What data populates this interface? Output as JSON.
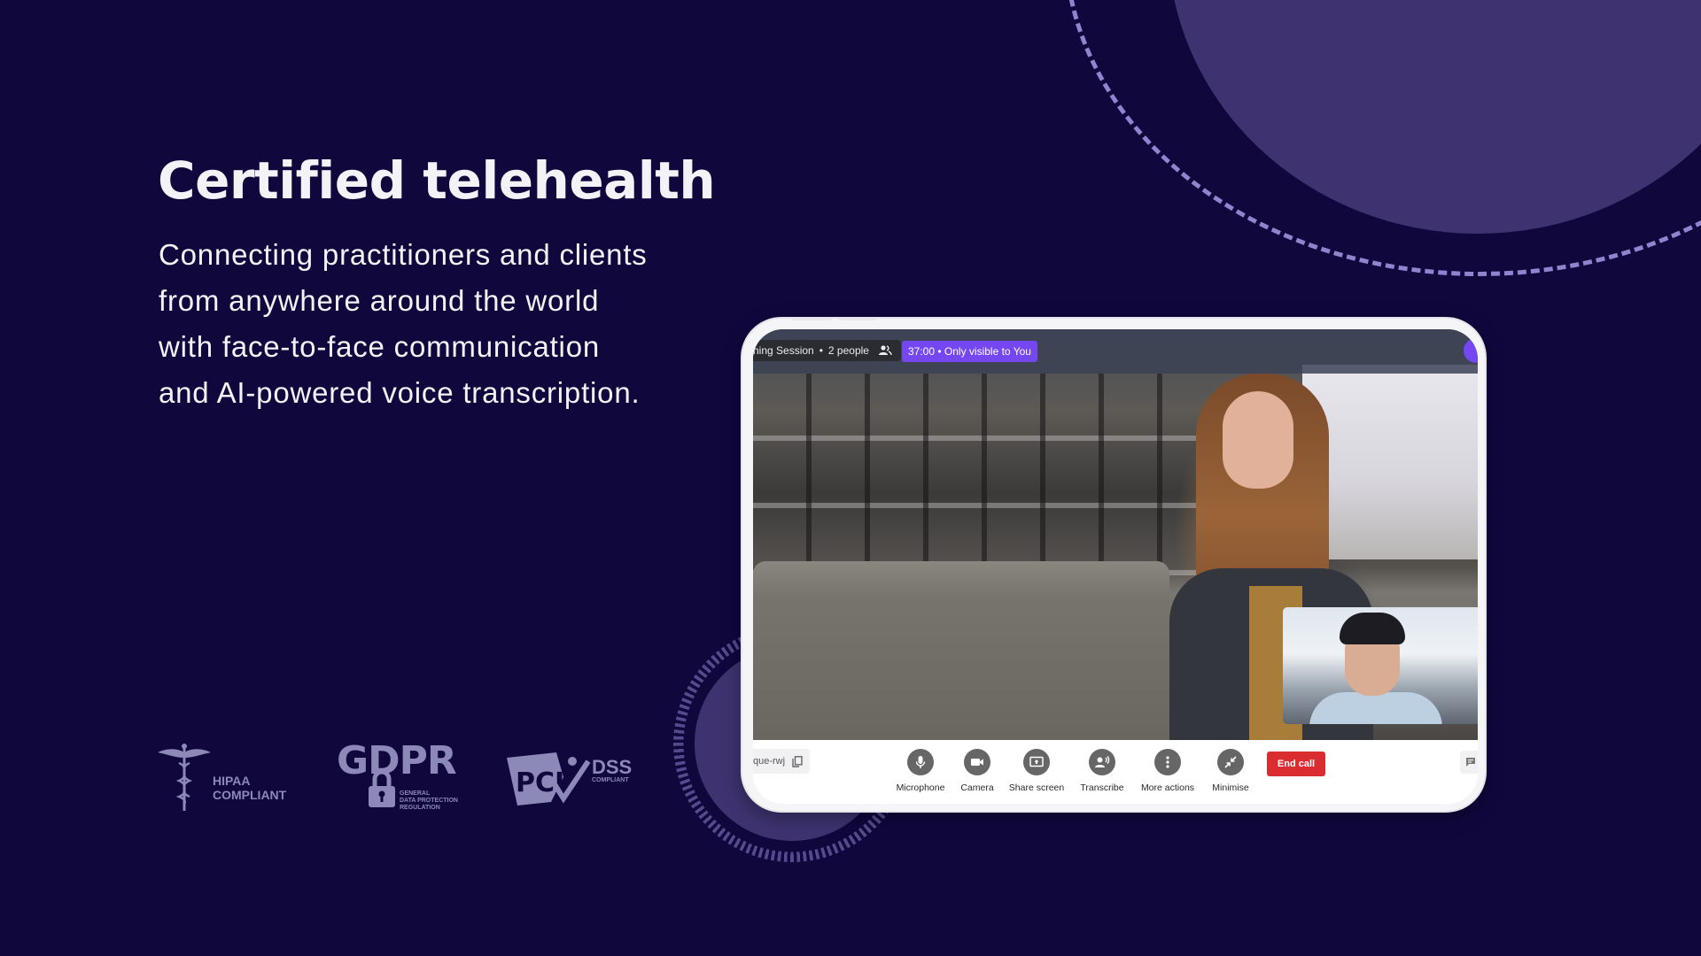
{
  "hero": {
    "title": "Certified telehealth",
    "description_lines": [
      "Connecting practitioners and clients",
      "from anywhere around the world",
      "with face-to-face communication",
      "and AI-powered voice transcription."
    ]
  },
  "compliance": {
    "hipaa": {
      "line1": "HIPAA",
      "line2": "COMPLIANT",
      "icon": "caduceus-icon"
    },
    "gdpr": {
      "title": "GDPR",
      "subtitle_lines": [
        "GENERAL",
        "DATA PROTECTION",
        "REGULATION"
      ],
      "icon": "padlock-icon"
    },
    "pci": {
      "brand": "PCI",
      "title": "DSS",
      "subtitle": "COMPLIANT",
      "icon": "checkmark-icon"
    }
  },
  "call": {
    "session_label": "hing Session",
    "separator": "•",
    "participants": "2 people",
    "timer_badge": "37:00 • Only visible to You",
    "meeting_code": "que-rwj",
    "controls": [
      {
        "label": "Microphone",
        "icon": "microphone-icon"
      },
      {
        "label": "Camera",
        "icon": "camera-icon"
      },
      {
        "label": "Share screen",
        "icon": "share-screen-icon"
      },
      {
        "label": "Transcribe",
        "icon": "transcribe-icon"
      },
      {
        "label": "More actions",
        "icon": "more-vertical-icon"
      },
      {
        "label": "Minimise",
        "icon": "minimise-icon"
      }
    ],
    "end_call_label": "End call"
  },
  "colors": {
    "background": "#10073d",
    "accent_purple": "#7447f0",
    "end_call_red": "#d92d32",
    "decor_circle": "#3e3370",
    "logo_gray": "#8c88b7"
  }
}
